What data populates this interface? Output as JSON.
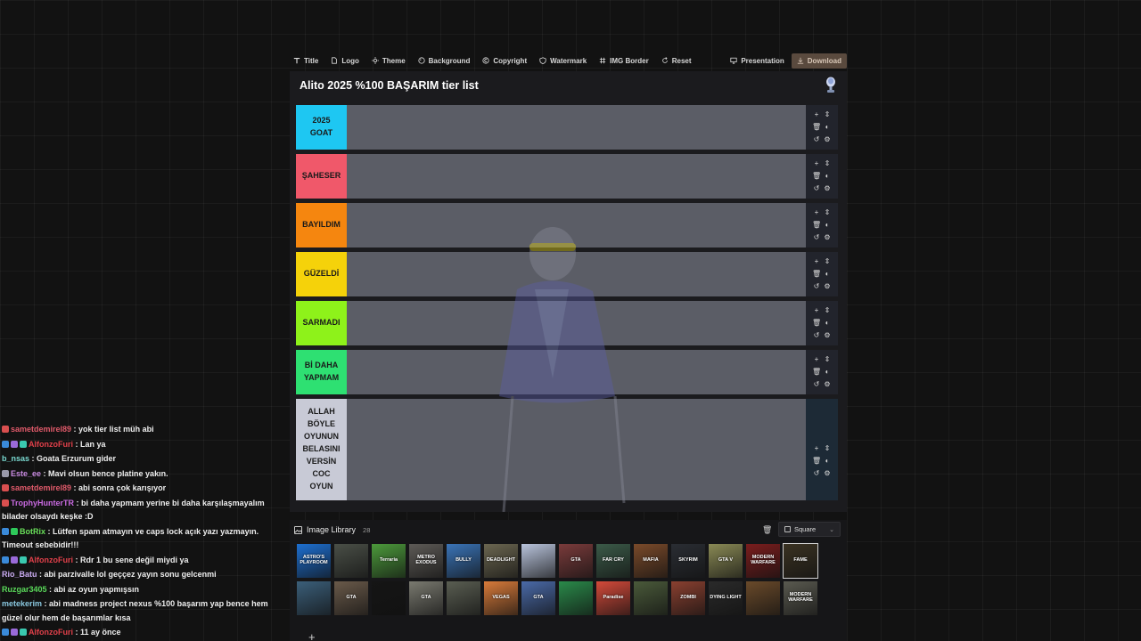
{
  "toolbar": {
    "items": [
      {
        "label": "Title",
        "icon": "text-icon"
      },
      {
        "label": "Logo",
        "icon": "file-icon"
      },
      {
        "label": "Theme",
        "icon": "sun-icon"
      },
      {
        "label": "Background",
        "icon": "palette-icon"
      },
      {
        "label": "Copyright",
        "icon": "copyright-icon"
      },
      {
        "label": "Watermark",
        "icon": "shield-icon"
      },
      {
        "label": "IMG Border",
        "icon": "frame-icon"
      },
      {
        "label": "Reset",
        "icon": "reset-icon"
      }
    ],
    "presentation_label": "Presentation",
    "download_label": "Download"
  },
  "tierlist": {
    "title": "Alito 2025 %100 BAŞARIM tier list",
    "tiers": [
      {
        "label": "2025\nGOAT",
        "color": "#1ec7f2"
      },
      {
        "label": "ŞAHESER",
        "color": "#f0586a"
      },
      {
        "label": "BAYILDIM",
        "color": "#f5860f"
      },
      {
        "label": "GÜZELDİ",
        "color": "#f5d20a"
      },
      {
        "label": "SARMADI",
        "color": "#8ef21a"
      },
      {
        "label": "Bİ DAHA\nYAPMAM",
        "color": "#2ee072"
      },
      {
        "label": "ALLAH\nBÖYLE\nOYUNUN\nBELASINI\nVERSİN\nCOC\nOYUN",
        "color": "#c8cad6"
      }
    ],
    "controls": [
      "+",
      "⇕",
      "🗑",
      "◐",
      "↺",
      "⚙"
    ]
  },
  "library": {
    "title": "Image Library",
    "count": "28",
    "shape_label": "Square",
    "add_label": "+",
    "thumbs": [
      {
        "text": "ASTRO'S PLAYROOM",
        "color": "#1d6fd1"
      },
      {
        "text": "",
        "color": "#4a4f47"
      },
      {
        "text": "Terraria",
        "color": "#4c9a3b"
      },
      {
        "text": "METRO EXODUS",
        "color": "#5d5a56"
      },
      {
        "text": "BULLY",
        "color": "#3a74b8"
      },
      {
        "text": "DEADLIGHT",
        "color": "#6b6650"
      },
      {
        "text": "",
        "color": "#b9c4dc"
      },
      {
        "text": "GTA",
        "color": "#7a3b3b"
      },
      {
        "text": "FAR CRY",
        "color": "#3b5a48"
      },
      {
        "text": "MAFIA",
        "color": "#7a4a2a"
      },
      {
        "text": "SKYRIM",
        "color": "#2a2d33"
      },
      {
        "text": "GTA V",
        "color": "#8a8a55"
      },
      {
        "text": "MODERN WARFARE",
        "color": "#7a1d1d"
      },
      {
        "text": "FAME",
        "color": "#3a3222"
      },
      {
        "text": "",
        "color": "#3b5f7a"
      },
      {
        "text": "GTA",
        "color": "#6a5a4a"
      },
      {
        "text": "",
        "color": "#151515"
      },
      {
        "text": "GTA",
        "color": "#7a7a70"
      },
      {
        "text": "",
        "color": "#5a5e52"
      },
      {
        "text": "VEGAS",
        "color": "#d97b3a"
      },
      {
        "text": "GTA",
        "color": "#4a6aa8"
      },
      {
        "text": "",
        "color": "#2a8a4a"
      },
      {
        "text": "Paradise",
        "color": "#d44a3a"
      },
      {
        "text": "",
        "color": "#4a5a3a"
      },
      {
        "text": "ZOMBI",
        "color": "#8a4030"
      },
      {
        "text": "DYING LIGHT",
        "color": "#2a2a2a"
      },
      {
        "text": "",
        "color": "#6a4a2a"
      },
      {
        "text": "MODERN WARFARE",
        "color": "#5a5a50"
      }
    ]
  },
  "chat": {
    "messages": [
      {
        "user": "sametdemirel89",
        "color": "#e05a6a",
        "badges": [
          "#d94f4f"
        ],
        "text": "yok tier list müh abi"
      },
      {
        "user": "AlfonzoFuri",
        "color": "#e0404a",
        "badges": [
          "#3a8ad9",
          "#9a6ad9",
          "#3ac9b0"
        ],
        "text": "Lan ya"
      },
      {
        "user": "b_nsas",
        "color": "#7ad9d0",
        "badges": [],
        "text": "Goata Erzurum gider"
      },
      {
        "user": "Este_ee",
        "color": "#c88ae0",
        "badges": [
          "#9a9aaa"
        ],
        "text": "Mavi olsun bence platine yakın."
      },
      {
        "user": "sametdemirel89",
        "color": "#e05a6a",
        "badges": [
          "#d94f4f"
        ],
        "text": "abi sonra çok karışıyor"
      },
      {
        "user": "TrophyHunterTR",
        "color": "#c86ae0",
        "badges": [
          "#d94f4f"
        ],
        "text": "bi daha yapmam yerine bi daha karşılaşmayalım bilader olsaydı keşke :D"
      },
      {
        "user": "BotRix",
        "color": "#6ae05a",
        "badges": [
          "#3a8ad9",
          "#2ec95a"
        ],
        "text": "Lütfen spam atmayın ve caps lock açık yazı yazmayın. Timeout sebebidir!!!"
      },
      {
        "user": "AlfonzoFuri",
        "color": "#e0404a",
        "badges": [
          "#3a8ad9",
          "#9a6ad9",
          "#3ac9b0"
        ],
        "text": "Rdr 1 bu sene değil miydi ya"
      },
      {
        "user": "Rio_Batu",
        "color": "#c8aaf0",
        "badges": [],
        "text": "abi parzivalle lol geççez yayın sonu gelcenmi"
      },
      {
        "user": "Ruzgar3405",
        "color": "#5ad95a",
        "badges": [],
        "text": "abi az oyun yapmışsın"
      },
      {
        "user": "metekerim",
        "color": "#8ac8e0",
        "badges": [],
        "text": "abi madness project nexus %100 başarım yap bence hem güzel olur hem de başarımlar kısa"
      },
      {
        "user": "AlfonzoFuri",
        "color": "#e0404a",
        "badges": [
          "#3a8ad9",
          "#9a6ad9",
          "#3ac9b0"
        ],
        "text": "11 ay önce"
      }
    ]
  }
}
